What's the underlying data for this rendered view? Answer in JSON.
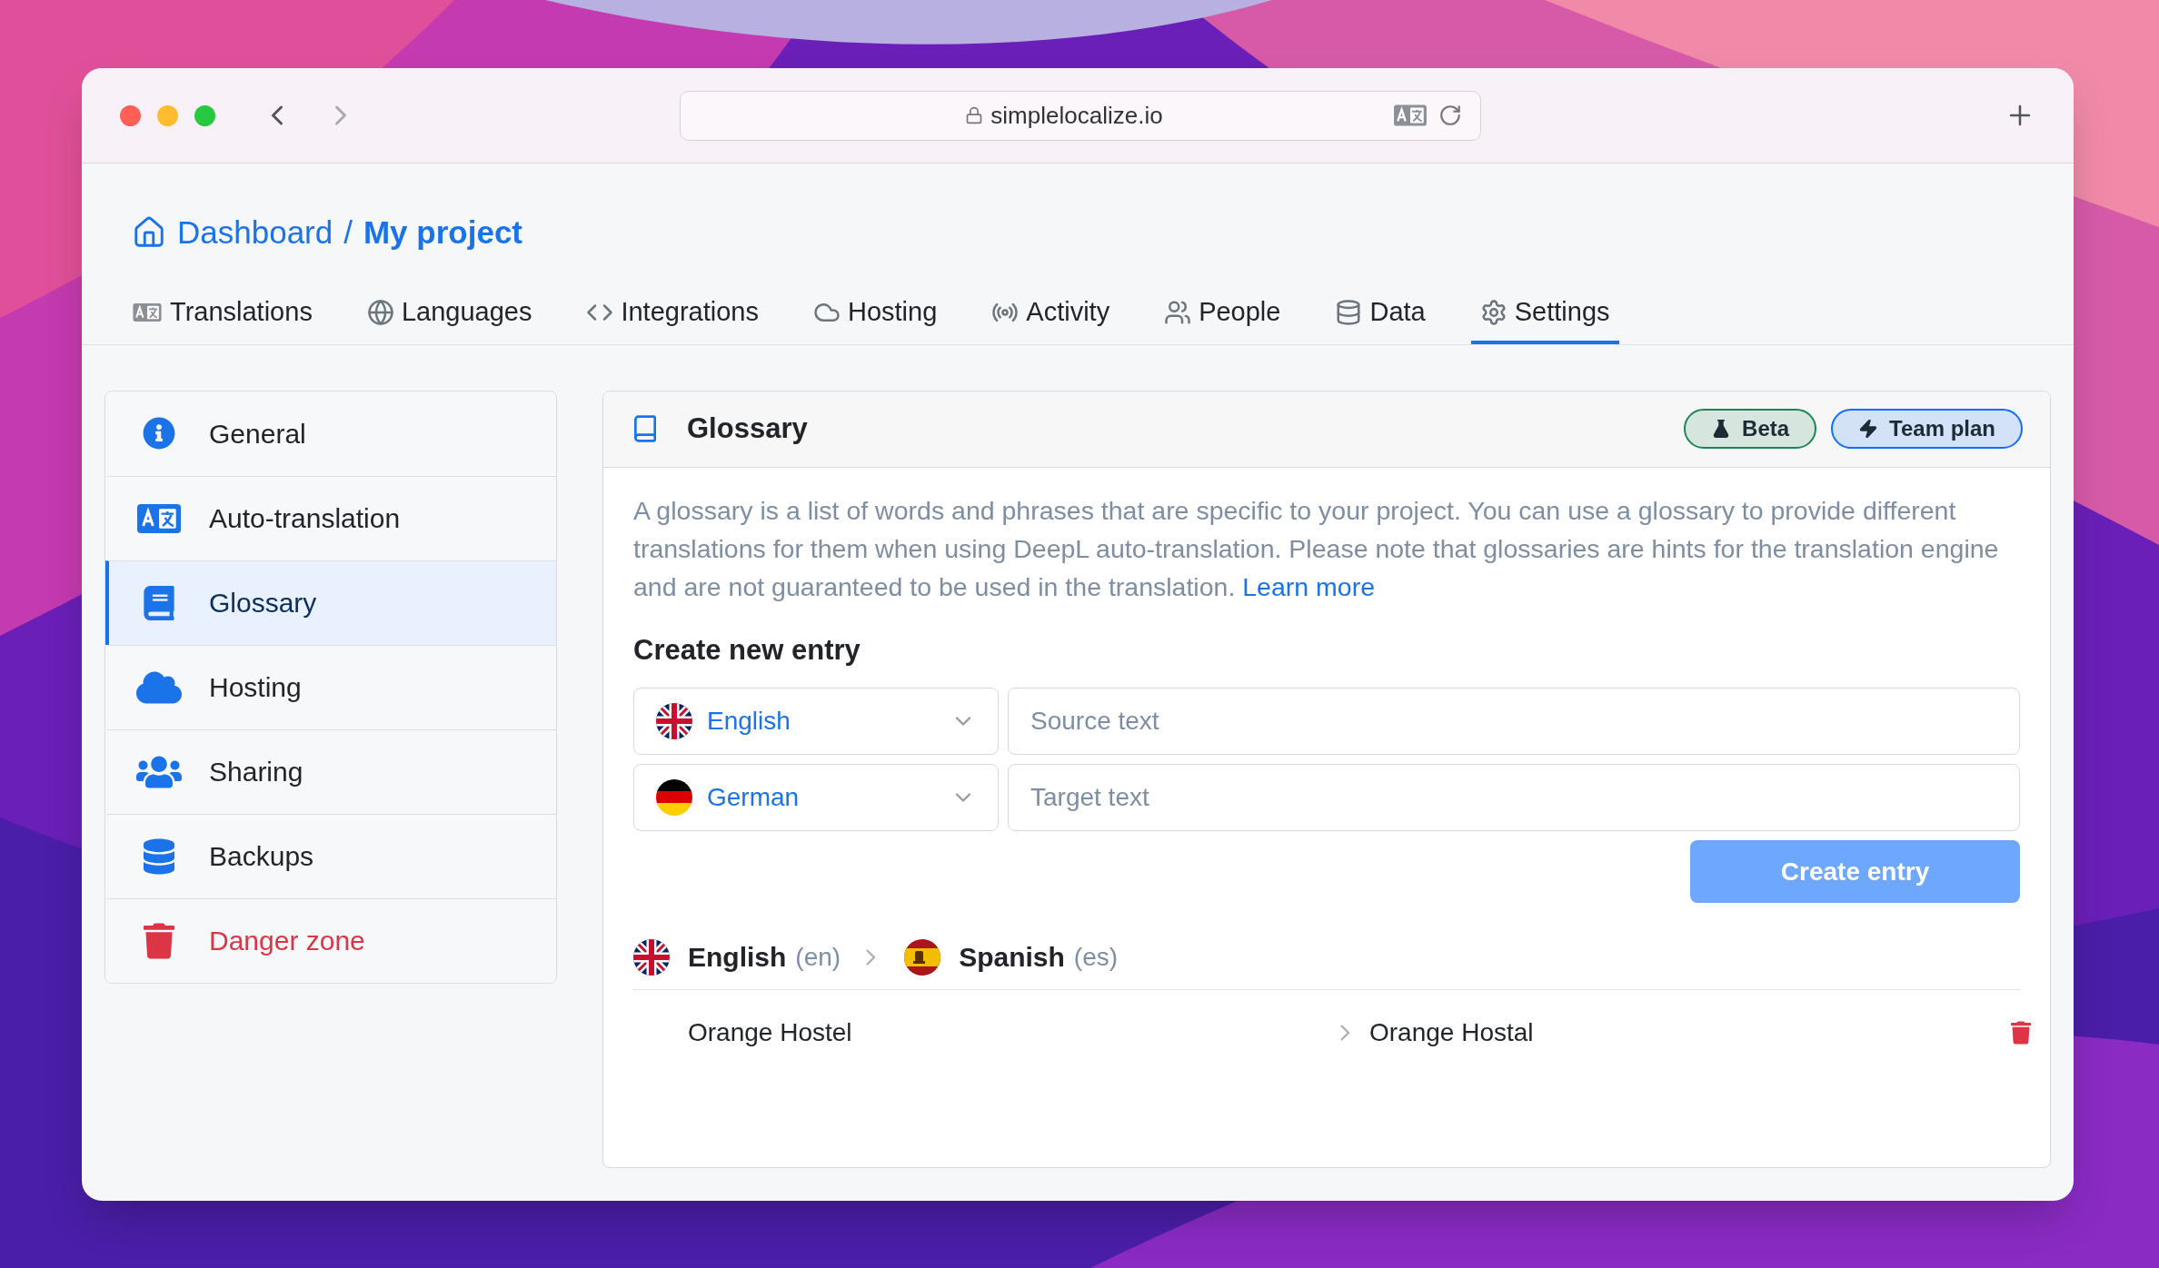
{
  "window": {
    "url": "simplelocalize.io"
  },
  "breadcrumb": {
    "home": "Dashboard",
    "separator": "/",
    "current": "My project"
  },
  "tabs": [
    {
      "label": "Translations",
      "selected": false
    },
    {
      "label": "Languages",
      "selected": false
    },
    {
      "label": "Integrations",
      "selected": false
    },
    {
      "label": "Hosting",
      "selected": false
    },
    {
      "label": "Activity",
      "selected": false
    },
    {
      "label": "People",
      "selected": false
    },
    {
      "label": "Data",
      "selected": false
    },
    {
      "label": "Settings",
      "selected": true
    }
  ],
  "sidebar": {
    "items": [
      {
        "label": "General",
        "selected": false,
        "kind": "normal"
      },
      {
        "label": "Auto-translation",
        "selected": false,
        "kind": "normal"
      },
      {
        "label": "Glossary",
        "selected": true,
        "kind": "normal"
      },
      {
        "label": "Hosting",
        "selected": false,
        "kind": "normal"
      },
      {
        "label": "Sharing",
        "selected": false,
        "kind": "normal"
      },
      {
        "label": "Backups",
        "selected": false,
        "kind": "normal"
      },
      {
        "label": "Danger zone",
        "selected": false,
        "kind": "danger"
      }
    ]
  },
  "panel": {
    "title": "Glossary",
    "badges": [
      {
        "label": "Beta",
        "color": "#198754"
      },
      {
        "label": "Team plan",
        "color": "#0d6efd"
      }
    ],
    "description": "A glossary is a list of words and phrases that are specific to your project. You can use a glossary to provide different translations for them when using DeepL auto-translation. Please note that glossaries are hints for the translation engine and are not guaranteed to be used in the translation.",
    "link": "Learn more",
    "form": {
      "heading": "Create new entry",
      "rows": [
        {
          "language": "English",
          "kind": "uk",
          "placeholder": "Source text"
        },
        {
          "language": "German",
          "kind": "de",
          "placeholder": "Target text"
        }
      ],
      "button": {
        "label": "Create entry",
        "disabled": true
      }
    },
    "pair": {
      "source": {
        "name": "English",
        "code": "(en)",
        "kind": "uk"
      },
      "target": {
        "name": "Spanish",
        "code": "(es)",
        "kind": "es"
      }
    },
    "entries": [
      {
        "source": "Orange Hostel",
        "target": "Orange Hostal"
      }
    ]
  }
}
